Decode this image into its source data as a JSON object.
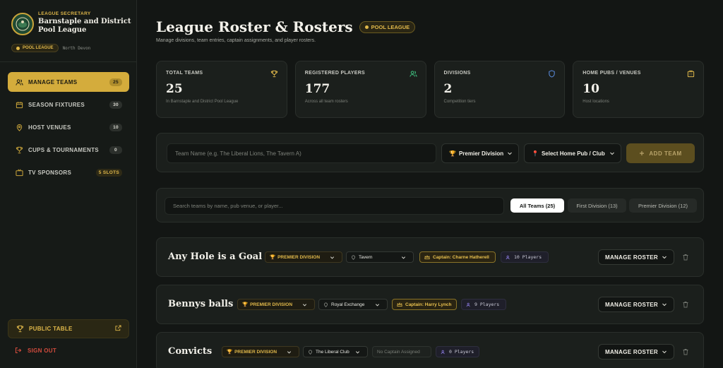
{
  "brand": {
    "kicker": "LEAGUE SECRETARY",
    "name": "Barnstaple and District Pool League",
    "tag": "POOL LEAGUE",
    "region": "North Devon"
  },
  "sidebar": {
    "items": [
      {
        "label": "MANAGE TEAMS",
        "badge": "25"
      },
      {
        "label": "SEASON FIXTURES",
        "badge": "30"
      },
      {
        "label": "HOST VENUES",
        "badge": "10"
      },
      {
        "label": "CUPS & TOURNAMENTS",
        "badge": "0"
      },
      {
        "label": "TV SPONSORS",
        "badge": "5 SLOTS"
      }
    ],
    "public_table": "PUBLIC TABLE",
    "sign_out": "SIGN OUT"
  },
  "header": {
    "title": "League Roster & Rosters",
    "pill": "POOL LEAGUE",
    "subtitle": "Manage divisions, team entries, captain assignments, and player rosters."
  },
  "stats": [
    {
      "label": "TOTAL TEAMS",
      "value": "25",
      "note": "In Barnstaple and District Pool League",
      "icon": "trophy-icon"
    },
    {
      "label": "REGISTERED PLAYERS",
      "value": "177",
      "note": "Across all team rosters",
      "icon": "users-icon"
    },
    {
      "label": "DIVISIONS",
      "value": "2",
      "note": "Competition tiers",
      "icon": "shield-icon"
    },
    {
      "label": "HOME PUBS / VENUES",
      "value": "10",
      "note": "Host locations",
      "icon": "building-icon"
    }
  ],
  "add_team": {
    "placeholder": "Team Name (e.g. The Liberal Lions, The Tavern A)",
    "division": "Premier Division",
    "venue": "Select Home Pub / Club",
    "button": "ADD TEAM"
  },
  "filter": {
    "placeholder": "Search teams by name, pub venue, or player...",
    "chips": [
      "All Teams (25)",
      "First Division (13)",
      "Premier Division (12)"
    ]
  },
  "teams": [
    {
      "name": "Any Hole is a Goal",
      "division": "PREMIER DIVISION",
      "venue": "Tavern",
      "captain": "Captain: Charne Hatherell",
      "players": "10 Players",
      "manage": "MANAGE ROSTER"
    },
    {
      "name": "Bennys balls",
      "division": "PREMIER DIVISION",
      "venue": "Royal Exchange",
      "captain": "Captain: Harry Lynch",
      "players": "9 Players",
      "manage": "MANAGE ROSTER"
    },
    {
      "name": "Convicts",
      "division": "PREMIER DIVISION",
      "venue": "The Liberal Club",
      "captain": "No Captain Assigned",
      "players": "0 Players",
      "manage": "MANAGE ROSTER"
    }
  ],
  "colors": {
    "accent": "#d4ac3c",
    "background": "#131614",
    "card": "#1b1f1c",
    "danger": "#d24b3d"
  }
}
